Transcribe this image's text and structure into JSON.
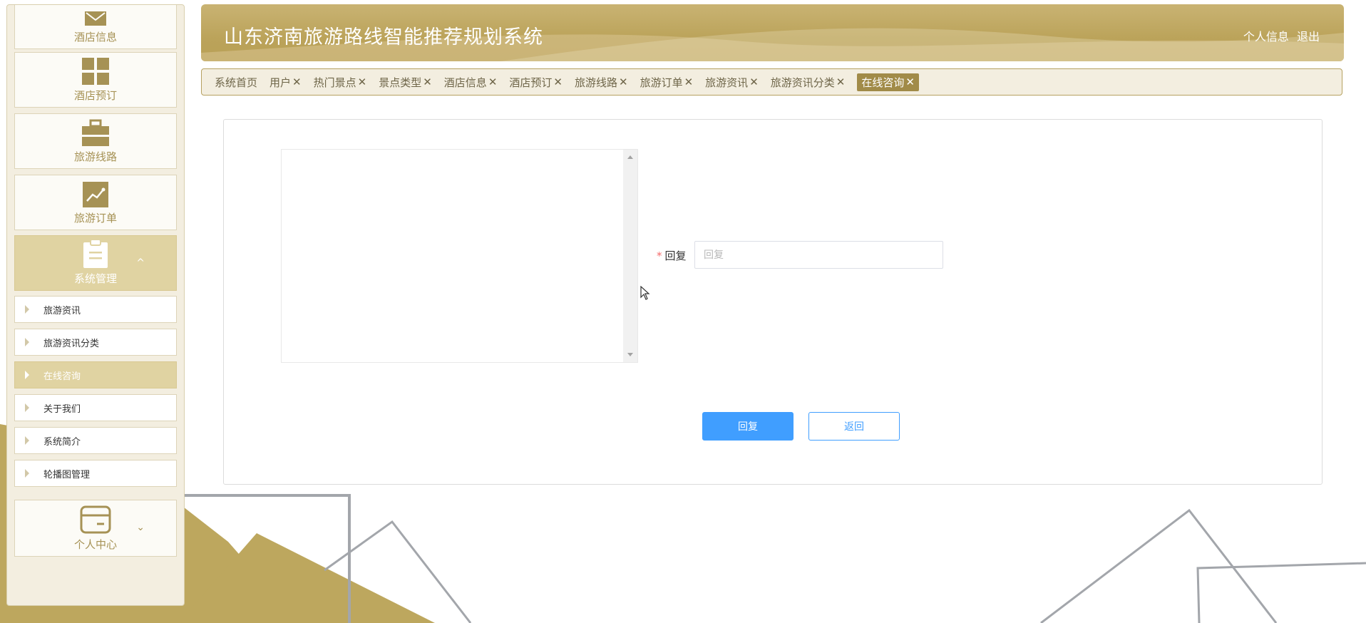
{
  "sidebar": {
    "menu": [
      {
        "label": "酒店信息",
        "icon": "envelope-icon"
      },
      {
        "label": "酒店预订",
        "icon": "grid-icon"
      },
      {
        "label": "旅游线路",
        "icon": "briefcase-icon"
      },
      {
        "label": "旅游订单",
        "icon": "chart-icon"
      },
      {
        "label": "系统管理",
        "icon": "clipboard-icon",
        "expanded": true,
        "chevron": "^"
      },
      {
        "label": "个人中心",
        "icon": "wallet-icon",
        "chevron": "⌄"
      }
    ],
    "submenu": [
      {
        "label": "旅游资讯"
      },
      {
        "label": "旅游资讯分类"
      },
      {
        "label": "在线咨询",
        "active": true
      },
      {
        "label": "关于我们"
      },
      {
        "label": "系统简介"
      },
      {
        "label": "轮播图管理"
      }
    ]
  },
  "header": {
    "title": "山东济南旅游路线智能推荐规划系统",
    "profile_link": "个人信息",
    "logout_link": "退出"
  },
  "tabs": [
    {
      "label": "系统首页",
      "closable": false
    },
    {
      "label": "用户",
      "closable": true
    },
    {
      "label": "热门景点",
      "closable": true
    },
    {
      "label": "景点类型",
      "closable": true
    },
    {
      "label": "酒店信息",
      "closable": true
    },
    {
      "label": "酒店预订",
      "closable": true
    },
    {
      "label": "旅游线路",
      "closable": true
    },
    {
      "label": "旅游订单",
      "closable": true
    },
    {
      "label": "旅游资讯",
      "closable": true
    },
    {
      "label": "旅游资讯分类",
      "closable": true
    },
    {
      "label": "在线咨询",
      "closable": true,
      "active": true
    }
  ],
  "tab_close_glyph": "✕",
  "form": {
    "reply_required_mark": "*",
    "reply_label": "回复",
    "reply_placeholder": "回复",
    "reply_value": "",
    "submit_label": "回复",
    "back_label": "返回"
  },
  "colors": {
    "brand_gold": "#bba35a",
    "accent_gold": "#a18b48",
    "primary_blue": "#409eff",
    "required_red": "#f56c6c"
  }
}
